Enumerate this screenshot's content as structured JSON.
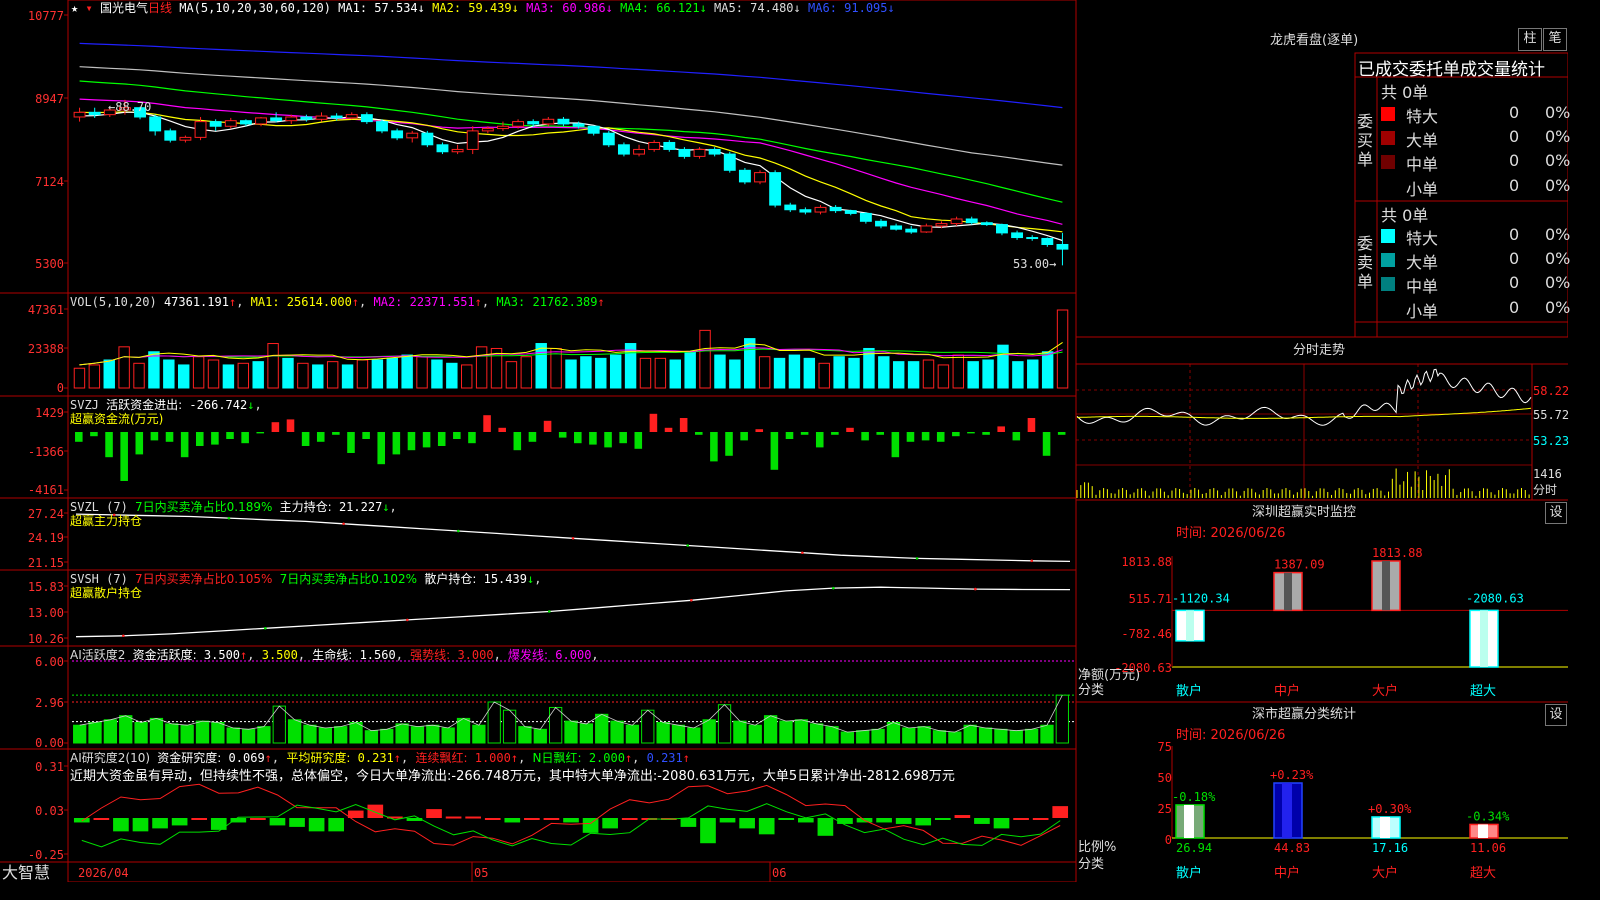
{
  "app": {
    "brand": "大智慧"
  },
  "stock": {
    "name": "国光电气",
    "period": "日线",
    "star": "★"
  },
  "colors": {
    "bg": "#000000",
    "border": "#b00000",
    "up": "#ff2020",
    "down": "#00ffff",
    "green": "#00e000",
    "ma1": "#ffffff",
    "ma2": "#ffff00",
    "ma3": "#ff00ff",
    "ma4": "#00ff00",
    "ma5": "#c0c0c0",
    "ma6": "#2020ff"
  },
  "main": {
    "ma_label": "MA(5,10,20,30,60,120)",
    "ma": [
      {
        "name": "MA1",
        "value": "57.534"
      },
      {
        "name": "MA2",
        "value": "59.439"
      },
      {
        "name": "MA3",
        "value": "60.986"
      },
      {
        "name": "MA4",
        "value": "66.121"
      },
      {
        "name": "MA5",
        "value": "74.480"
      },
      {
        "name": "MA6",
        "value": "91.095"
      }
    ],
    "y_ticks": [
      "10777",
      "8947",
      "7124",
      "5300"
    ],
    "high_label": "88.70",
    "low_label": "53.00"
  },
  "vol": {
    "label": "VOL(5,10,20)",
    "value": "47361.191",
    "ma1": "25614.000",
    "ma2": "22371.551",
    "ma3": "21762.389",
    "y_ticks": [
      "47361",
      "23388",
      "0"
    ]
  },
  "svzj": {
    "label": "SVZJ",
    "name": "活跃资金进出:",
    "value": "-266.742",
    "subtitle": "超赢资金流(万元)",
    "y_ticks": [
      "1429",
      "-1366",
      "-4161"
    ]
  },
  "svzl": {
    "label": "SVZL (7)",
    "seg1": "7日内买卖净占比0.189%",
    "seg2": "主力持仓:",
    "value": "21.227",
    "subtitle": "超赢主力持仓",
    "y_ticks": [
      "27.24",
      "24.19",
      "21.15"
    ]
  },
  "svsh": {
    "label": "SVSH (7)",
    "seg1": "7日内买卖净占比0.105%",
    "seg2": "7日内买卖净占比0.102%",
    "seg3": "散户持仓:",
    "value": "15.439",
    "subtitle": "超赢散户持仓",
    "y_ticks": [
      "15.83",
      "13.00",
      "10.26"
    ]
  },
  "ai1": {
    "label": "AI活跃度2",
    "name": "资金活跃度:",
    "v1": "3.500",
    "v2": "3.500",
    "s1": "生命线:",
    "v3": "1.560",
    "s2": "强势线:",
    "v4": "3.000",
    "s3": "爆发线:",
    "v5": "6.000",
    "y_ticks": [
      "6.00",
      "2.96",
      "0.00"
    ]
  },
  "ai2": {
    "label": "AI研究度2(10)",
    "name": "资金研究度:",
    "v1": "0.069",
    "s1": "平均研究度:",
    "v2": "0.231",
    "s2": "连续飘红:",
    "v3": "1.000",
    "s3": "N日飘红:",
    "v4": "2.000",
    "v5": "0.231",
    "comment": "近期大资金虽有异动，但持续性不强，总体偏空，今日大单净流出:-266.748万元，其中特大单净流出:-2080.631万元，大单5日累计净出-2812.698万元",
    "y_ticks": [
      "0.31",
      "0.03",
      "-0.25"
    ]
  },
  "x_axis": [
    "2026/04",
    "05",
    "06"
  ],
  "right": {
    "title": "龙虎看盘(逐单)",
    "btn1": "柱",
    "btn2": "笔",
    "subtitle": "已成交委托单成交量统计",
    "buy_label": "委买单",
    "sell_label": "委卖单",
    "buy_total": "共 0单",
    "sell_total": "共 0单",
    "buy_rows": [
      {
        "name": "特大",
        "count": "0",
        "pct": "0%"
      },
      {
        "name": "大单",
        "count": "0",
        "pct": "0%"
      },
      {
        "name": "中单",
        "count": "0",
        "pct": "0%"
      },
      {
        "name": "小单",
        "count": "0",
        "pct": "0%"
      }
    ],
    "sell_rows": [
      {
        "name": "特大",
        "count": "0",
        "pct": "0%"
      },
      {
        "name": "大单",
        "count": "0",
        "pct": "0%"
      },
      {
        "name": "中单",
        "count": "0",
        "pct": "0%"
      },
      {
        "name": "小单",
        "count": "0",
        "pct": "0%"
      }
    ],
    "fenshi_title": "分时走势",
    "fenshi_ticks": [
      "58.22",
      "55.72",
      "53.23",
      "1416",
      "分时"
    ],
    "monitor_title": "深圳超赢实时监控",
    "monitor_time": "时间: 2026/06/26",
    "monitor_y": [
      "1813.88",
      "515.71",
      "-782.46",
      "-2080.63"
    ],
    "monitor_unit": "净额(万元)",
    "monitor_cat_label": "分类",
    "monitor_cats": [
      "散户",
      "中户",
      "大户",
      "超大"
    ],
    "set_label": "设",
    "stats_title": "深市超赢分类统计",
    "stats_time": "时间: 2026/06/26",
    "stats_y": [
      "75",
      "50",
      "25",
      "0"
    ],
    "stats_unit": "比例%",
    "stats_cat_label": "分类",
    "stats_cats": [
      "散户",
      "中户",
      "大户",
      "超大"
    ]
  },
  "chart_data": [
    {
      "type": "candlestick",
      "title": "国光电气 日线",
      "ylim": [
        53.0,
        107.77
      ],
      "high": 88.7,
      "low": 53.0,
      "candles": [
        [
          85,
          86,
          84,
          87
        ],
        [
          86,
          85.5,
          84.8,
          87
        ],
        [
          85.5,
          86.5,
          85,
          87
        ],
        [
          86.5,
          87,
          85.5,
          88.7
        ],
        [
          87,
          85,
          84.5,
          87.2
        ],
        [
          85,
          82,
          81,
          85.5
        ],
        [
          82,
          80,
          79.5,
          82.5
        ],
        [
          80,
          80.6,
          79.5,
          81
        ],
        [
          80.6,
          84,
          80,
          85
        ],
        [
          84,
          83,
          82,
          84.5
        ],
        [
          83,
          84.2,
          82.5,
          84.8
        ],
        [
          84.2,
          83.5,
          83,
          84.5
        ],
        [
          83.5,
          84.8,
          83,
          85
        ],
        [
          84.8,
          84.2,
          83.8,
          86
        ],
        [
          84.2,
          85,
          83.5,
          85.5
        ],
        [
          85,
          84.5,
          84,
          85.5
        ],
        [
          84.5,
          85.2,
          84,
          86
        ],
        [
          85.2,
          84.8,
          84.2,
          85.8
        ],
        [
          84.8,
          85.5,
          84.5,
          86
        ],
        [
          85.5,
          84,
          83.5,
          86
        ],
        [
          84,
          82,
          81.5,
          84.5
        ],
        [
          82,
          80.5,
          80,
          82.5
        ],
        [
          80.5,
          81.5,
          79.5,
          82
        ],
        [
          81.5,
          79,
          78.5,
          82
        ],
        [
          79,
          77.5,
          77,
          79.5
        ],
        [
          77.5,
          78,
          77,
          79
        ],
        [
          78,
          82,
          77,
          83
        ],
        [
          82,
          82.5,
          81.5,
          83
        ],
        [
          82.5,
          83,
          82,
          84
        ],
        [
          83,
          84,
          82.5,
          84.5
        ],
        [
          84,
          83.5,
          82.8,
          84.5
        ],
        [
          83.5,
          84.5,
          83,
          85
        ],
        [
          84.5,
          83.5,
          83,
          85
        ],
        [
          83.5,
          83,
          82.5,
          84
        ],
        [
          83,
          81.5,
          81,
          83
        ],
        [
          81.5,
          79,
          78.5,
          82
        ],
        [
          79,
          77,
          76.5,
          79.5
        ],
        [
          77,
          78,
          76.5,
          79
        ],
        [
          78,
          79.5,
          77.5,
          80
        ],
        [
          79.5,
          78,
          77.5,
          80
        ],
        [
          78,
          76.5,
          76,
          78.5
        ],
        [
          76.5,
          78,
          76,
          78.5
        ],
        [
          78,
          77,
          76.5,
          78.5
        ],
        [
          77,
          73.5,
          73,
          77.5
        ],
        [
          73.5,
          71,
          70.5,
          74
        ],
        [
          71,
          73,
          70.5,
          73.5
        ],
        [
          73,
          66,
          65.5,
          73.5
        ],
        [
          66,
          65,
          64.5,
          66.5
        ],
        [
          65,
          64.5,
          64,
          65.5
        ],
        [
          64.5,
          65.5,
          64,
          66
        ],
        [
          65.5,
          64.8,
          64.3,
          66
        ],
        [
          64.8,
          64.2,
          63.8,
          65
        ],
        [
          64.2,
          62.5,
          62,
          64.5
        ],
        [
          62.5,
          61.5,
          61,
          63
        ],
        [
          61.5,
          60.8,
          60.5,
          62
        ],
        [
          60.8,
          60.2,
          59.8,
          61.5
        ],
        [
          60.2,
          61.5,
          60,
          62
        ],
        [
          61.5,
          62,
          61,
          62.5
        ],
        [
          62,
          63,
          61.5,
          63.5
        ],
        [
          63,
          62.2,
          61.8,
          63.5
        ],
        [
          62.2,
          61.8,
          61.5,
          62.5
        ],
        [
          61.8,
          60,
          59.5,
          62
        ],
        [
          60,
          59,
          58.5,
          60.5
        ],
        [
          59,
          58.8,
          58.3,
          59.5
        ],
        [
          58.8,
          57.5,
          57,
          59
        ],
        [
          57.5,
          56.5,
          53,
          60
        ]
      ]
    },
    {
      "type": "bar",
      "title": "VOL",
      "ylim": [
        0,
        47361
      ],
      "values": [
        12000,
        14000,
        17000,
        25000,
        15000,
        22000,
        17000,
        14000,
        19000,
        17000,
        14000,
        15000,
        16000,
        27000,
        18000,
        15000,
        14000,
        16000,
        14000,
        17000,
        17000,
        18000,
        20000,
        19000,
        17000,
        15000,
        14000,
        25000,
        24000,
        16000,
        19000,
        27000,
        24000,
        17000,
        19000,
        18000,
        20000,
        27000,
        18000,
        18000,
        17000,
        22000,
        35000,
        20000,
        17000,
        30000,
        19000,
        18000,
        20000,
        18000,
        15000,
        19000,
        18000,
        24000,
        19000,
        16000,
        16000,
        17000,
        14000,
        20000,
        16000,
        17000,
        26000,
        16000,
        17000,
        22000,
        47361
      ]
    },
    {
      "type": "bar",
      "title": "SVZJ",
      "values": [
        -700,
        -300,
        -1800,
        -3500,
        -1600,
        -600,
        -700,
        -1800,
        -1000,
        -900,
        -500,
        -800,
        -100,
        700,
        900,
        -1000,
        -700,
        -200,
        -1500,
        -500,
        -2300,
        -1600,
        -1300,
        -1100,
        -1000,
        -500,
        -800,
        1200,
        300,
        -1300,
        -700,
        800,
        -400,
        -800,
        -900,
        -1100,
        -800,
        -1200,
        1300,
        300,
        1000,
        -200,
        -2100,
        -1700,
        -600,
        200,
        -2700,
        -500,
        -200,
        -1100,
        -200,
        300,
        -600,
        -200,
        -1800,
        -700,
        -600,
        -700,
        -300,
        -100,
        -200,
        400,
        -600,
        1000,
        -1700,
        -200
      ]
    },
    {
      "type": "line",
      "title": "SVZL 主力持仓",
      "ylim": [
        21.15,
        27.24
      ],
      "values": [
        27.1,
        27.0,
        26.9,
        26.8,
        26.6,
        26.4,
        26.2,
        25.9,
        25.6,
        25.3,
        25.0,
        24.7,
        24.4,
        24.1,
        23.8,
        23.5,
        23.2,
        22.9,
        22.6,
        22.3,
        22.0,
        21.8,
        21.6,
        21.5,
        21.4,
        21.3,
        21.23
      ]
    },
    {
      "type": "line",
      "title": "SVSH 散户持仓",
      "ylim": [
        10.26,
        15.83
      ],
      "values": [
        10.4,
        10.5,
        10.7,
        11.0,
        11.3,
        11.6,
        11.9,
        12.2,
        12.5,
        12.8,
        13.1,
        13.5,
        13.9,
        14.3,
        14.8,
        15.3,
        15.6,
        15.7,
        15.6,
        15.5,
        15.45,
        15.44
      ]
    },
    {
      "type": "bar",
      "title": "AI活跃度",
      "ylim": [
        0,
        6
      ],
      "values": [
        1.3,
        1.5,
        1.7,
        2.0,
        1.5,
        1.8,
        1.4,
        1.3,
        1.6,
        1.5,
        1.1,
        1.0,
        1.2,
        2.7,
        1.7,
        1.3,
        1.1,
        1.2,
        1.5,
        0.9,
        1.0,
        1.4,
        1.2,
        1.3,
        1.1,
        1.8,
        1.3,
        3.0,
        2.4,
        1.2,
        1.0,
        2.6,
        1.6,
        1.4,
        2.1,
        1.6,
        1.3,
        2.4,
        1.5,
        1.3,
        1.1,
        1.7,
        2.8,
        1.6,
        1.3,
        2.0,
        1.6,
        1.7,
        1.4,
        1.2,
        0.8,
        0.9,
        1.0,
        1.5,
        1.1,
        1.2,
        0.9,
        0.8,
        1.3,
        1.1,
        1.0,
        0.9,
        1.0,
        1.3,
        3.5
      ]
    },
    {
      "type": "bar",
      "title": "AI研究度",
      "values": [
        -0.03,
        0.0,
        -0.09,
        -0.09,
        -0.07,
        -0.05,
        0.0,
        -0.08,
        -0.03,
        0.0,
        -0.05,
        -0.06,
        -0.09,
        -0.09,
        0.05,
        0.09,
        0.01,
        -0.02,
        0.06,
        0.01,
        0.01,
        0.0,
        -0.03,
        0.0,
        0.0,
        -0.03,
        -0.1,
        -0.07,
        0.0,
        0.0,
        0.0,
        -0.06,
        -0.17,
        -0.03,
        -0.07,
        -0.11,
        -0.01,
        -0.03,
        -0.12,
        -0.04,
        -0.03,
        -0.03,
        -0.04,
        -0.05,
        -0.01,
        0.02,
        -0.04,
        -0.07,
        0.0,
        0.0,
        0.08
      ]
    },
    {
      "type": "bar",
      "title": "深圳超赢实时监控",
      "categories": [
        "散户",
        "中户",
        "大户",
        "超大"
      ],
      "values": [
        -1120.34,
        1387.09,
        1813.88,
        -2080.63
      ],
      "ylim": [
        -2080.63,
        1813.88
      ]
    },
    {
      "type": "bar",
      "title": "深市超赢分类统计",
      "categories": [
        "散户",
        "中户",
        "大户",
        "超大"
      ],
      "values": [
        26.94,
        44.83,
        17.16,
        11.06
      ],
      "changes": [
        "-0.18%",
        "+0.23%",
        "+0.30%",
        "-0.34%"
      ],
      "ylim": [
        0,
        75
      ]
    }
  ]
}
